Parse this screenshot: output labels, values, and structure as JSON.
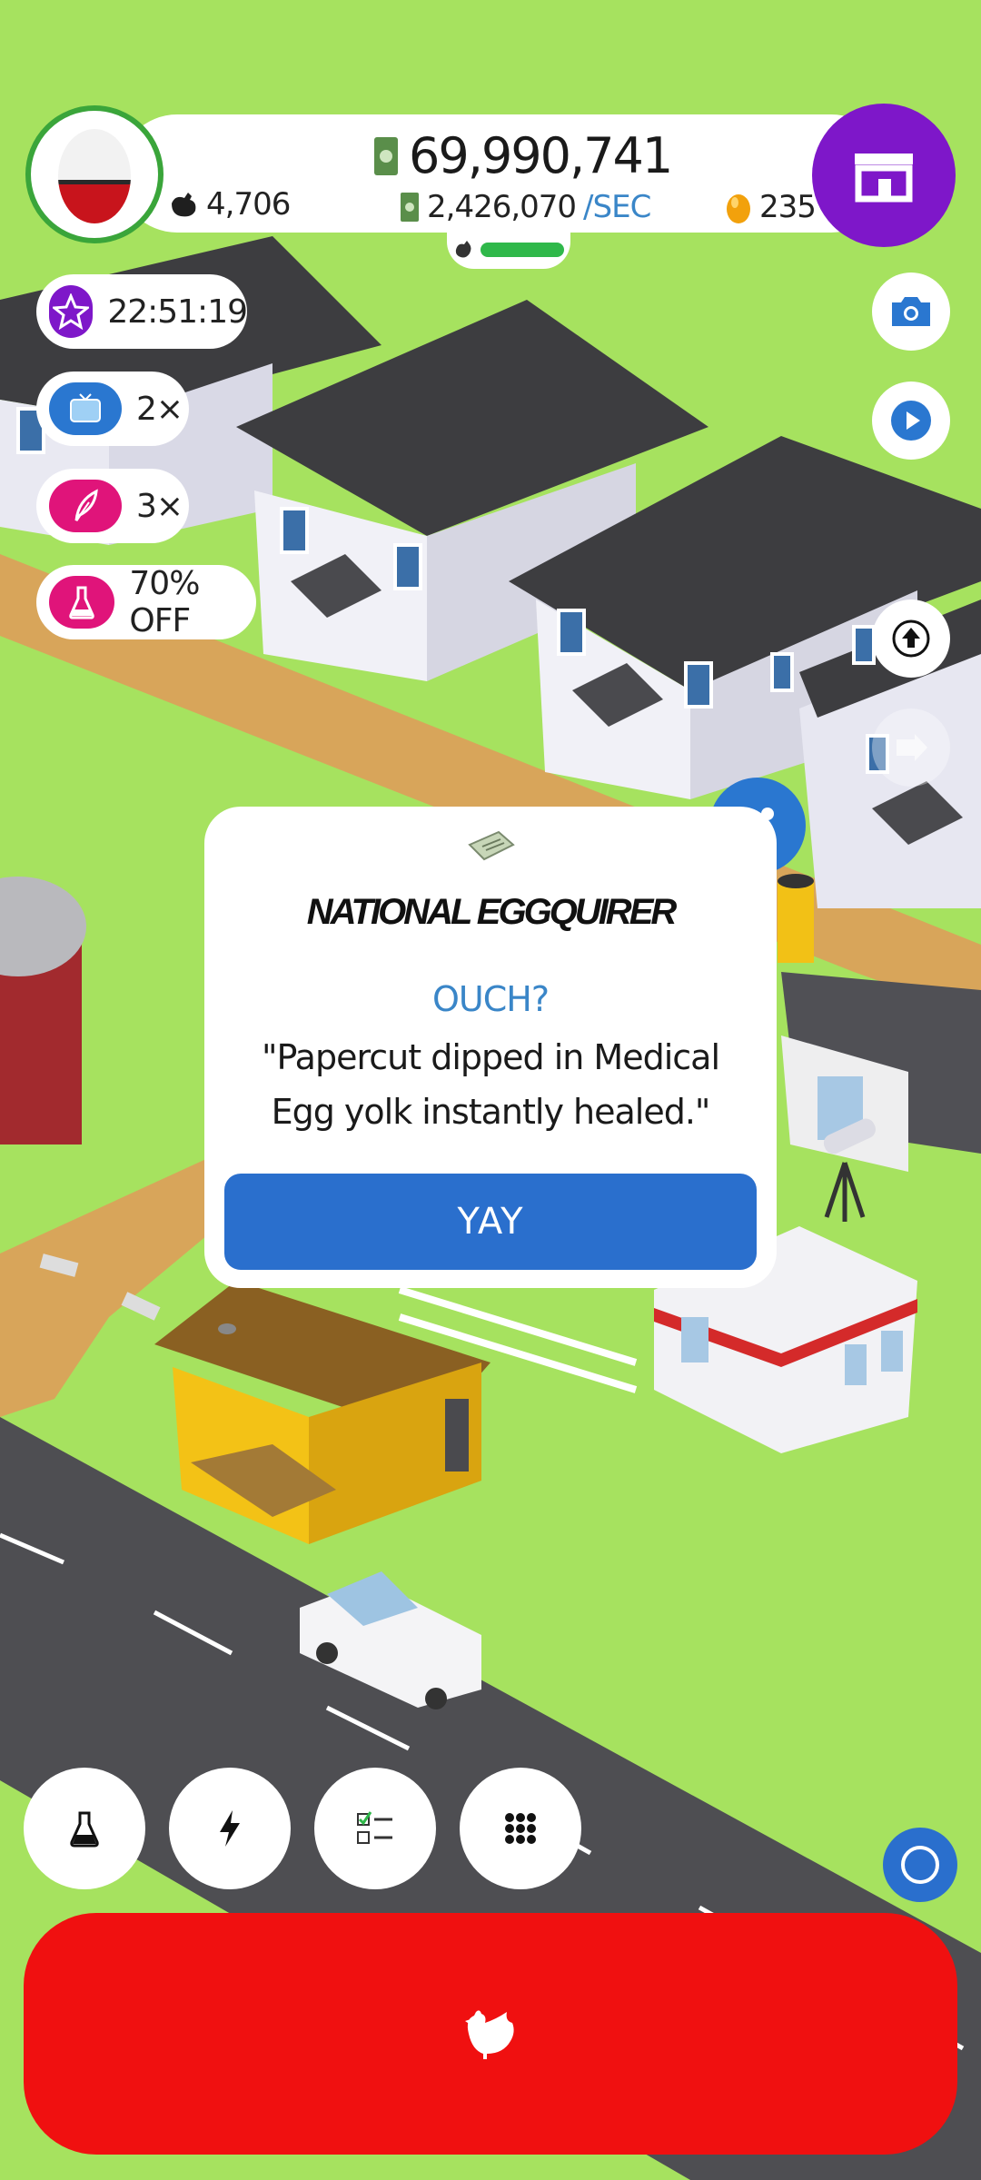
{
  "hud": {
    "money": "69,990,741",
    "chickens": "4,706",
    "rate_value": "2,426,070",
    "rate_unit": "/SEC",
    "golden_eggs": "235"
  },
  "boosts": [
    {
      "label": "22:51:19",
      "icon": "star-icon",
      "color": "#7e17c9"
    },
    {
      "label": "2×",
      "icon": "tv-icon",
      "color": "#2a77d0"
    },
    {
      "label": "3×",
      "icon": "feather-icon",
      "color": "#e0147a"
    },
    {
      "label": "70% OFF",
      "icon": "flask-icon",
      "color": "#e0147a"
    }
  ],
  "news": {
    "headline": "NATIONAL EGGQUIRER",
    "subtitle": "OUCH?",
    "body": "\"Papercut dipped in Medical Egg yolk instantly healed.\"",
    "button": "YAY"
  },
  "colors": {
    "grass": "#a6e25f",
    "shop": "#7e17c9",
    "hatch": "#f01010",
    "primary": "#2a6fcd"
  }
}
